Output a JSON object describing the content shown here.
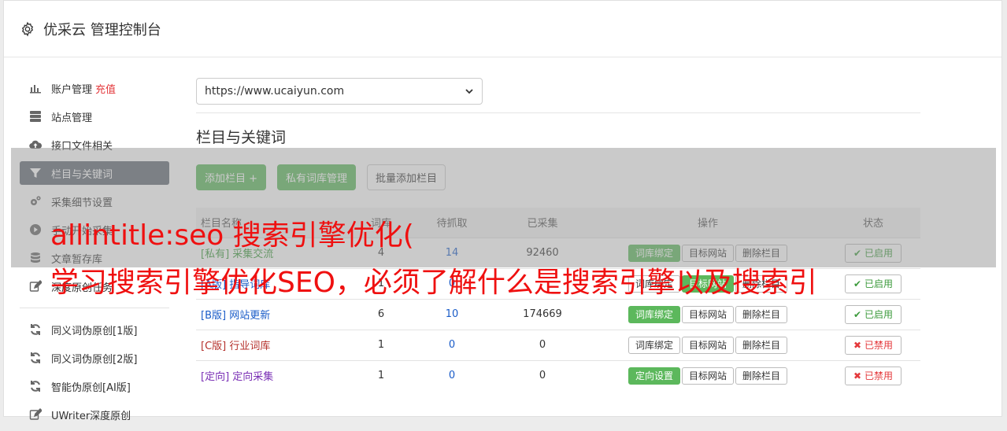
{
  "header": {
    "title": "优采云 管理控制台"
  },
  "sidebar": {
    "items": [
      {
        "label": "账户管理",
        "extra": "充值",
        "icon": "bar-chart-icon"
      },
      {
        "label": "站点管理",
        "icon": "server-icon"
      },
      {
        "label": "接口文件相关",
        "icon": "cloud-upload-icon"
      },
      {
        "label": "栏目与关键词",
        "icon": "filter-icon"
      },
      {
        "label": "采集细节设置",
        "icon": "cogs-icon"
      },
      {
        "label": "手动开始采集",
        "icon": "play-icon"
      },
      {
        "label": "文章暂存库",
        "icon": "database-icon"
      },
      {
        "label": "深度原创任务",
        "icon": "edit-icon"
      }
    ],
    "items2": [
      {
        "label": "同义词伪原创[1版]",
        "icon": "refresh-icon"
      },
      {
        "label": "同义词伪原创[2版]",
        "icon": "refresh-icon"
      },
      {
        "label": "智能伪原创[AI版]",
        "icon": "refresh-icon"
      },
      {
        "label": "UWriter深度原创",
        "icon": "edit-icon"
      }
    ]
  },
  "main": {
    "site_select": "https://www.ucaiyun.com",
    "section_title": "栏目与关键词",
    "buttons": {
      "add_column": "添加栏目 +",
      "private_lib": "私有词库管理",
      "batch_add": "批量添加栏目"
    },
    "table": {
      "headers": [
        "栏目名称",
        "词库",
        "待抓取",
        "已采集",
        "操作",
        "状态"
      ],
      "rows": [
        {
          "tag": "[私有]",
          "name": "采集交流",
          "a": "4",
          "b": "14",
          "c": "92460",
          "op1": "词库绑定",
          "op2": "目标网站",
          "op3": "删除栏目",
          "status": "已启用",
          "op1_green": true,
          "op2_green": false,
          "on": true,
          "color": "#3c9a3c"
        },
        {
          "tag": "[A版]",
          "name": "指导词库",
          "a": "1",
          "b": "0",
          "c": "",
          "op1": "词库绑定",
          "op2": "目标网站",
          "op3": "删除栏目",
          "status": "已启用",
          "op1_green": false,
          "op2_green": true,
          "on": true,
          "color": "#1a5cc8"
        },
        {
          "tag": "[B版]",
          "name": "网站更新",
          "a": "6",
          "b": "10",
          "c": "174669",
          "op1": "词库绑定",
          "op2": "目标网站",
          "op3": "删除栏目",
          "status": "已启用",
          "op1_green": true,
          "op2_green": false,
          "on": true,
          "color": "#1a5cc8"
        },
        {
          "tag": "[C版]",
          "name": "行业词库",
          "a": "1",
          "b": "0",
          "c": "0",
          "op1": "词库绑定",
          "op2": "目标网站",
          "op3": "删除栏目",
          "status": "已禁用",
          "op1_green": false,
          "op2_green": false,
          "on": false,
          "color": "#b5312c"
        },
        {
          "tag": "[定向]",
          "name": "定向采集",
          "a": "1",
          "b": "0",
          "c": "0",
          "op1": "定向设置",
          "op2": "目标网站",
          "op3": "删除栏目",
          "status": "已禁用",
          "op1_green": true,
          "op2_green": false,
          "on": false,
          "color": "#7a2fb5"
        }
      ]
    }
  },
  "overlay_text": {
    "line1": "allintitle:seo 搜索引擎优化(",
    "line2": "学习搜索引擎优化SEO，必须了解什么是搜索引擎以及搜索引"
  },
  "colors": {
    "accent": "#5cb85c",
    "active_nav": "#636b75",
    "danger": "#e4393c"
  }
}
